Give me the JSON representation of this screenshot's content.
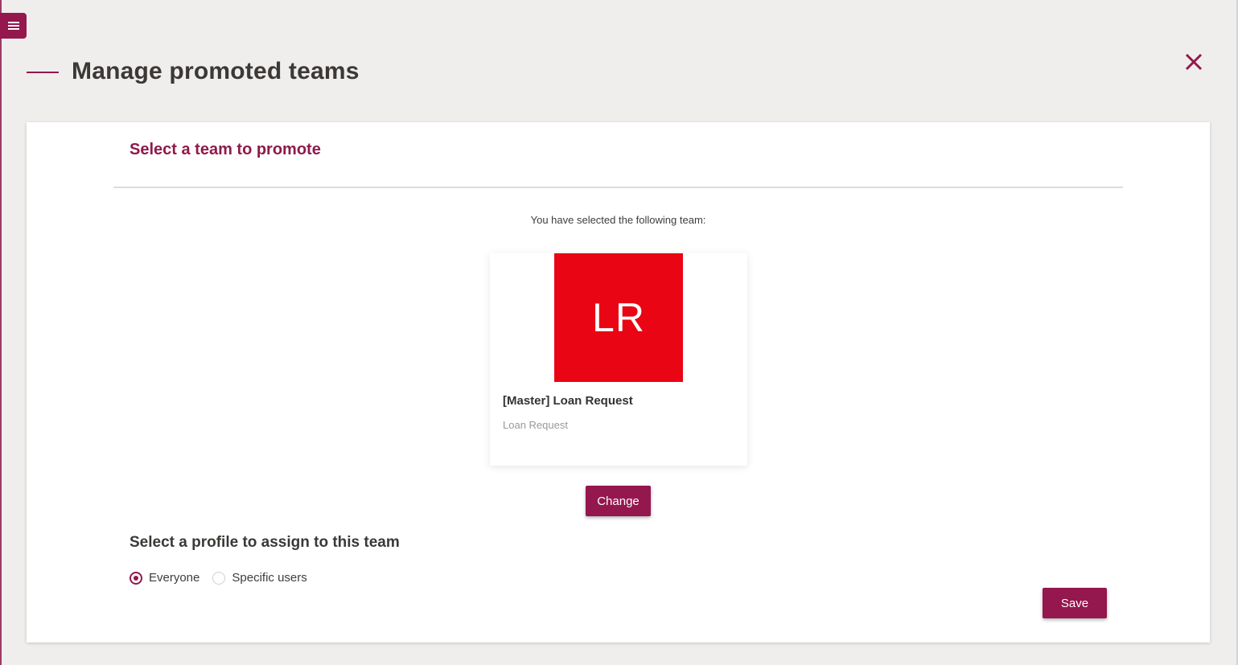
{
  "header": {
    "title": "Manage promoted teams",
    "menu_icon": "hamburger-menu-icon",
    "close_icon": "close-icon"
  },
  "select_team": {
    "section_title": "Select a team to promote",
    "selected_text": "You have selected the following team:",
    "team": {
      "initials": "LR",
      "name": "[Master] Loan Request",
      "subtitle": "Loan Request",
      "avatar_color": "#ea0514"
    },
    "change_label": "Change"
  },
  "profile": {
    "section_title": "Select a profile to assign to this team",
    "options": [
      {
        "label": "Everyone",
        "selected": true
      },
      {
        "label": "Specific users",
        "selected": false
      }
    ]
  },
  "footer": {
    "save_label": "Save"
  },
  "colors": {
    "accent": "#94174d",
    "background": "#efeeed"
  }
}
